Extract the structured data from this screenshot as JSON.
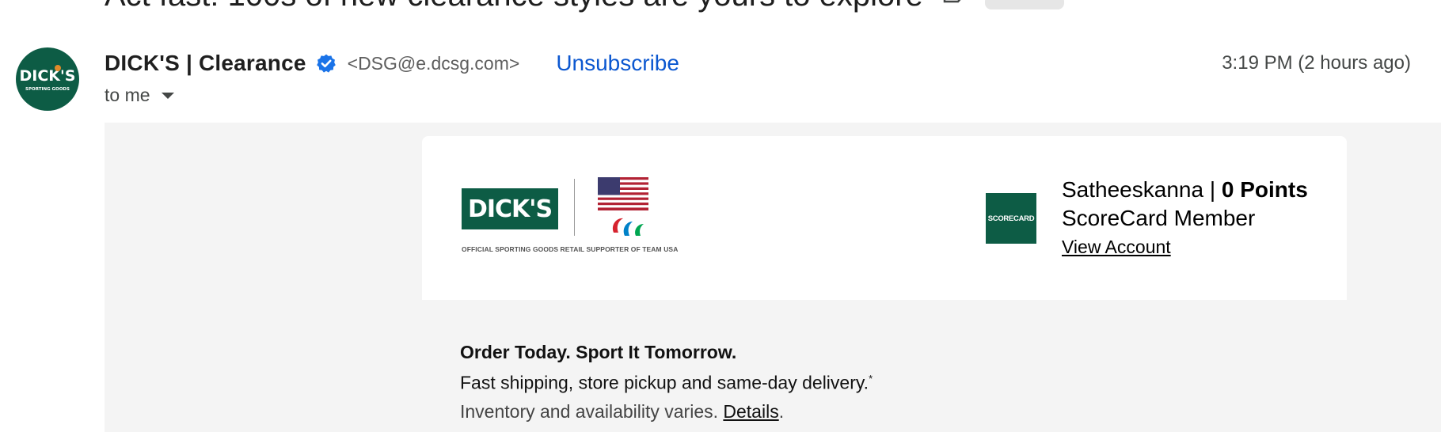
{
  "subject": {
    "text": "Act fast! 100s of new clearance styles are yours to explore"
  },
  "sender": {
    "name": "DICK'S | Clearance",
    "email": "<DSG@e.dcsg.com>",
    "unsubscribe_label": "Unsubscribe",
    "timestamp": "3:19 PM (2 hours ago)",
    "to_label": "to me",
    "avatar_text": "DICK'S",
    "avatar_subtext": "SPORTING GOODS"
  },
  "header_card": {
    "brand_logo_text": "DICK'S",
    "supporter_text": "OFFICIAL SPORTING GOODS RETAIL SUPPORTER OF TEAM USA",
    "scorecard_logo_text": "SCORECARD",
    "member_name": "Satheeskanna",
    "separator": " | ",
    "points": "0 Points",
    "member_status": "ScoreCard Member",
    "view_account_label": "View Account"
  },
  "promo": {
    "heading": "Order Today. Sport It Tomorrow.",
    "line": "Fast shipping, store pickup and same-day delivery.",
    "line_sup": "*",
    "small_text": "Inventory and availability varies. ",
    "details_label": "Details",
    "details_suffix": "."
  },
  "colors": {
    "brand_green": "#0d5c45",
    "link_blue": "#0b57d0",
    "body_bg": "#f4f4f4"
  },
  "icons": [
    "verified-badge-icon",
    "chevron-down-icon",
    "label-icon"
  ]
}
